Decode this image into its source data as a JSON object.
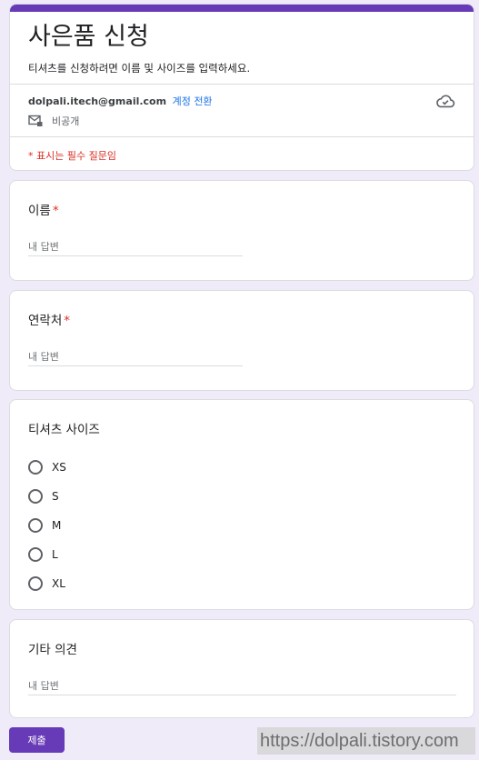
{
  "colors": {
    "accent": "#673ab7",
    "required": "#d93025",
    "link": "#1a73e8",
    "background": "#f0ebf8"
  },
  "form": {
    "title": "사은품 신청",
    "description": "티셔츠를 신청하려면 이름 및 사이즈를 입력하세요.",
    "account_email": "dolpali.itech@gmail.com",
    "switch_account": "계정 전환",
    "cloud_icon": "cloud-check-icon",
    "private_icon": "mail-lock-icon",
    "private_label": "비공개",
    "required_note": "* 표시는 필수 질문임"
  },
  "questions": {
    "name": {
      "title": "이름",
      "required_mark": "*",
      "placeholder": "내 답변"
    },
    "contact": {
      "title": "연락처",
      "required_mark": "*",
      "placeholder": "내 답변"
    },
    "size": {
      "title": "티셔츠 사이즈",
      "options": [
        "XS",
        "S",
        "M",
        "L",
        "XL"
      ]
    },
    "comment": {
      "title": "기타 의견",
      "placeholder": "내 답변"
    }
  },
  "submit_label": "제출",
  "watermark": "https://dolpali.tistory.com"
}
